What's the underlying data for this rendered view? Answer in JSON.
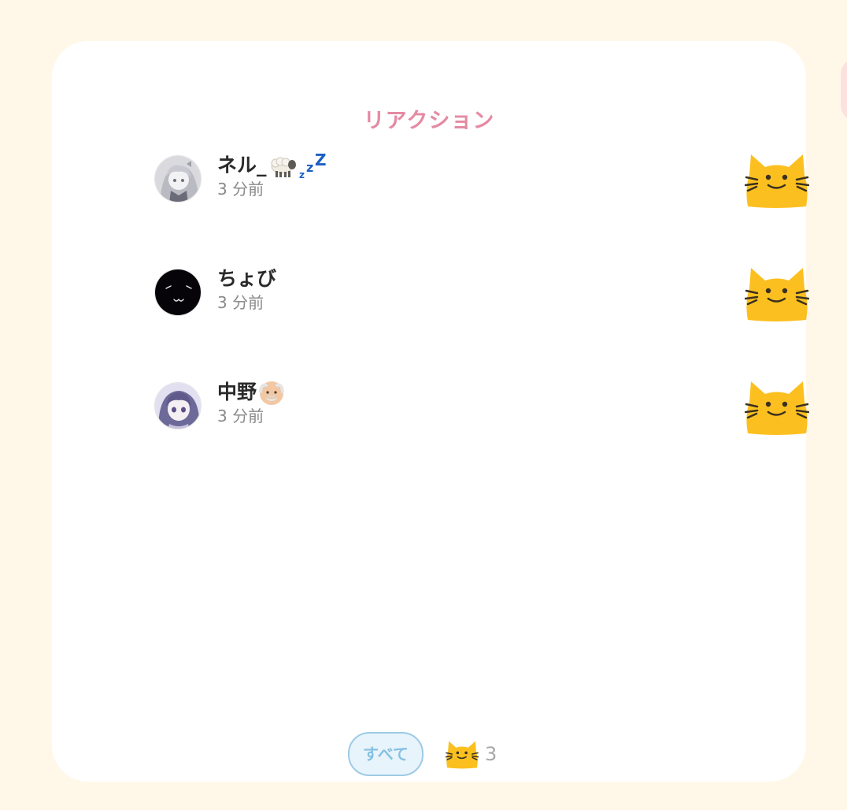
{
  "modal": {
    "title": "リアクション"
  },
  "reactions": [
    {
      "name": "ネル_",
      "name_emojis": [
        "sheep-emoji",
        "zzz-emoji"
      ],
      "time": "3 分前",
      "reaction": "blobcat-emoji",
      "avatar": "anime-girl-gray-avatar"
    },
    {
      "name": "ちょび",
      "name_emojis": [],
      "time": "3 分前",
      "reaction": "blobcat-emoji",
      "avatar": "black-face-avatar"
    },
    {
      "name": "中野",
      "name_emojis": [
        "old-man-emoji"
      ],
      "time": "3 分前",
      "reaction": "blobcat-emoji",
      "avatar": "anime-girl-purple-avatar"
    }
  ],
  "tabs": {
    "all_label": "すべて",
    "cat_count": "3"
  },
  "colors": {
    "background": "#fff8e9",
    "title": "#e58aa3",
    "tab_active_bg": "#e8f4fb",
    "tab_active_border": "#9ccbe6",
    "cat_yellow": "#fbc020"
  }
}
